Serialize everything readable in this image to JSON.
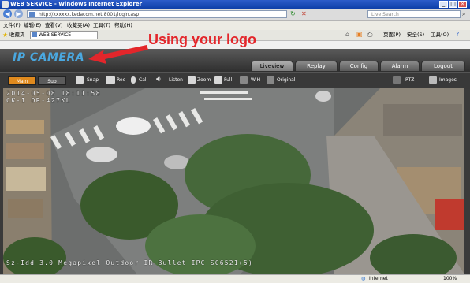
{
  "window": {
    "title": "WEB SERVICE - Windows Internet Explorer",
    "controls": [
      "_",
      "□",
      "×"
    ]
  },
  "address_bar": {
    "url": "http://xxxxxx.kedacom.net:8001/login.asp",
    "search_placeholder": "Live Search"
  },
  "menu": [
    "文件(F)",
    "编辑(E)",
    "查看(V)",
    "收藏夹(A)",
    "工具(T)",
    "帮助(H)"
  ],
  "favorites_bar": {
    "label": "收藏夹",
    "tab_title": "WEB SERVICE",
    "commands": [
      "页面(P)",
      "安全(S)",
      "工具(O)"
    ]
  },
  "annotation": {
    "text": "Using  your logo",
    "color": "#e3262b"
  },
  "logo": {
    "text": "IP CAMERA",
    "color": "#4aa8e0"
  },
  "nav_tabs": [
    {
      "label": "Liveview",
      "active": true
    },
    {
      "label": "Replay",
      "active": false
    },
    {
      "label": "Config",
      "active": false
    },
    {
      "label": "Alarm",
      "active": false
    },
    {
      "label": "Logout",
      "active": false
    }
  ],
  "toolbar": {
    "main_stream": "Main Stream",
    "sub_stream": "Sub Stream",
    "snap": "Snap",
    "rec": "Rec",
    "call": "Call",
    "listen": "Listen",
    "zoom": "Zoom",
    "full": "Full",
    "wh": "W:H",
    "original": "Original",
    "ptz": "PTZ",
    "images": "Images",
    "accent": "#e08a1e"
  },
  "video": {
    "osd_timestamp": "2014-05-08 18:11:58",
    "osd_camera_id": "CK-1 DR-427KL",
    "osd_caption": "Sz-Idd 3.0 Megapixel Outdoor IR Bullet IPC SC6521(5)"
  },
  "status_bar": {
    "zone": "Internet",
    "zoom": "100%"
  }
}
